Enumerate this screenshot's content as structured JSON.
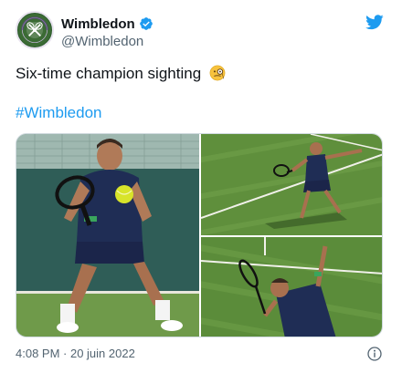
{
  "account": {
    "display_name": "Wimbledon",
    "handle": "@Wimbledon",
    "avatar_text_top": "THE CHAMPIONSHIPS",
    "avatar_text_bottom": "WIMBLEDON"
  },
  "tweet": {
    "text": "Six-time champion sighting",
    "emoji": "face-with-monocle-emoji",
    "hashtag": "#Wimbledon",
    "timestamp": "4:08 PM · 20 juin 2022"
  },
  "media": {
    "count": 3,
    "photos": [
      {
        "description_icon": "tennis-player-forehand-photo"
      },
      {
        "description_icon": "tennis-player-reaching-photo"
      },
      {
        "description_icon": "tennis-player-serving-photo"
      }
    ]
  },
  "colors": {
    "link": "#1d9bf0",
    "text": "#0f1419",
    "secondary": "#536471",
    "grass": "#5a8f3a",
    "kit_navy": "#1f2d55"
  },
  "icons": {
    "platform": "twitter-bird-icon",
    "verified": "verified-badge-icon",
    "info": "info-icon"
  }
}
